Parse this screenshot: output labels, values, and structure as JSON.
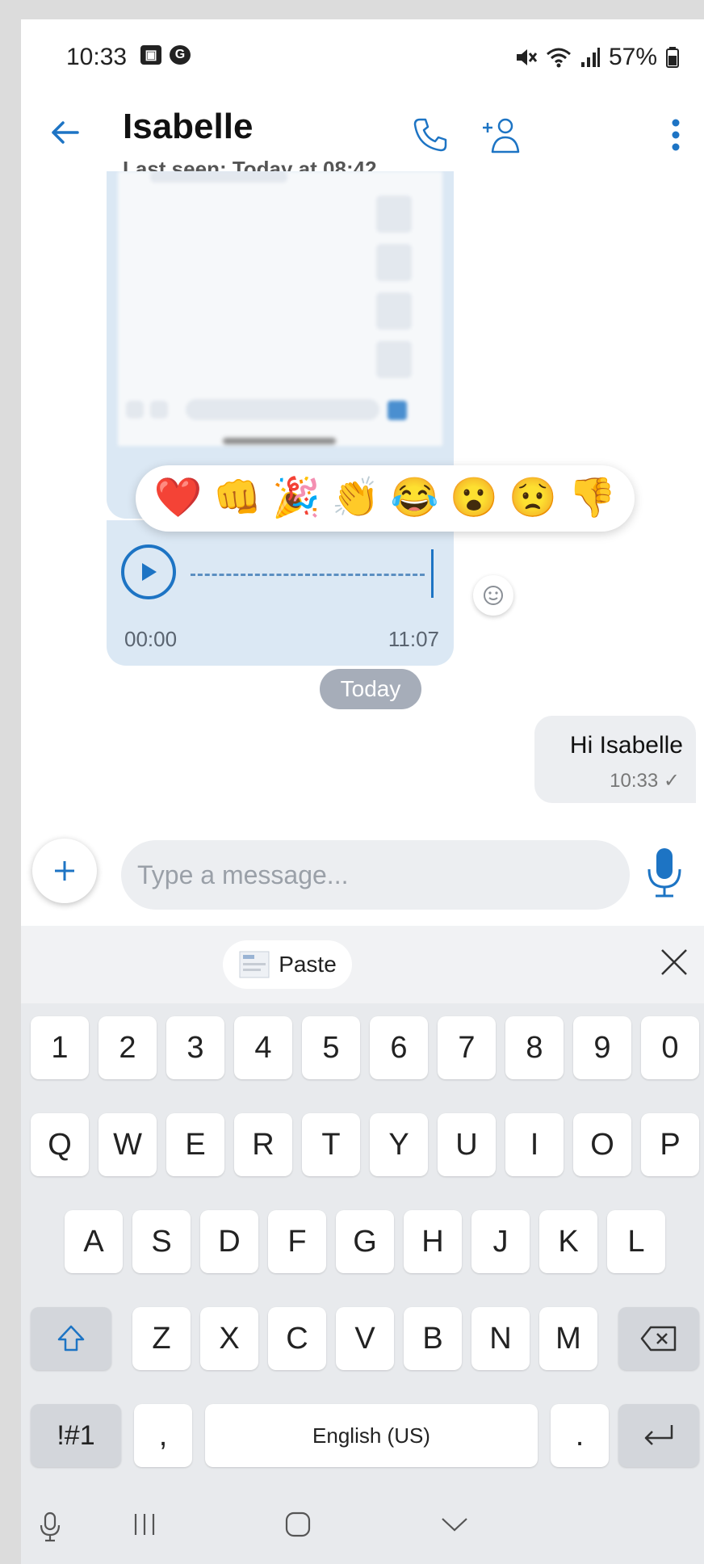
{
  "status_bar": {
    "time": "10:33",
    "notif_icons": [
      "image-icon",
      "google-icon"
    ],
    "battery": "57%"
  },
  "header": {
    "contact_name": "Isabelle",
    "last_seen": "Last seen: Today at 08:42"
  },
  "messages": {
    "voice": {
      "start_time": "00:00",
      "end_time": "11:07"
    },
    "day_separator": "Today",
    "outgoing": {
      "text": "Hi Isabelle",
      "time": "10:33",
      "status": "✓"
    }
  },
  "reactions": [
    "❤️",
    "👊",
    "🎉",
    "👏",
    "😂",
    "😮",
    "😟",
    "👎"
  ],
  "composer": {
    "placeholder": "Type a message..."
  },
  "keyboard": {
    "paste_label": "Paste",
    "row1": [
      "1",
      "2",
      "3",
      "4",
      "5",
      "6",
      "7",
      "8",
      "9",
      "0"
    ],
    "row2": [
      "Q",
      "W",
      "E",
      "R",
      "T",
      "Y",
      "U",
      "I",
      "O",
      "P"
    ],
    "row3": [
      "A",
      "S",
      "D",
      "F",
      "G",
      "H",
      "J",
      "K",
      "L"
    ],
    "row4": [
      "Z",
      "X",
      "C",
      "V",
      "B",
      "N",
      "M"
    ],
    "symbols_label": "!#1",
    "comma": ",",
    "space_label": "English (US)",
    "period": "."
  },
  "colors": {
    "accent": "#1d74c4",
    "bubble_in": "#dbe8f4",
    "bubble_out": "#eceef1"
  }
}
